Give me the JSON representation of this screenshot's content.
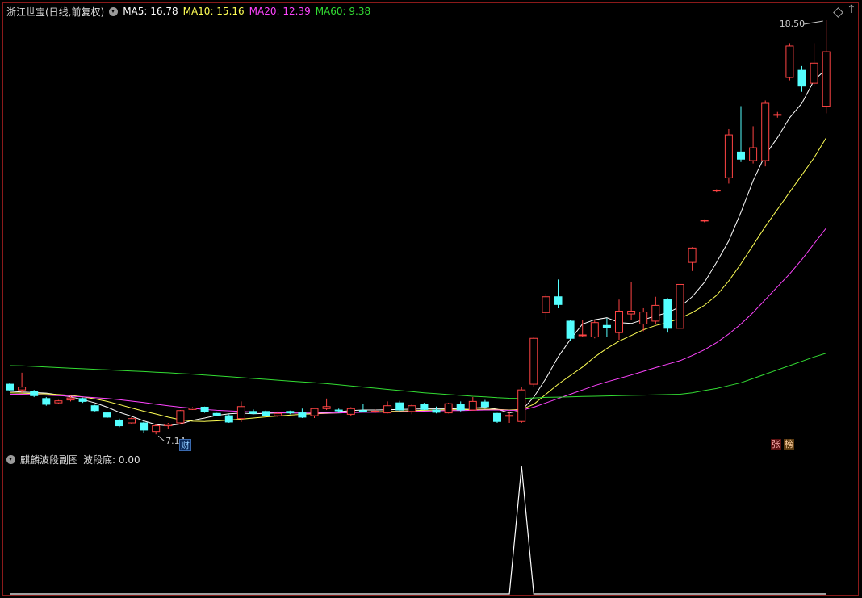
{
  "stock_name": "浙江世宝(日线,前复权)",
  "ma_legend": [
    {
      "label": "MA5: 16.78",
      "color": "#ffffff"
    },
    {
      "label": "MA10: 15.16",
      "color": "#ffff55"
    },
    {
      "label": "MA20: 12.39",
      "color": "#ff44ff"
    },
    {
      "label": "MA60: 9.38",
      "color": "#33dd33"
    }
  ],
  "sub_panel": {
    "title": "麒麟波段副图",
    "indicator": "波段底: 0.00"
  },
  "markers": {
    "high_label": "18.50",
    "low_label": "7.14",
    "cai": "财",
    "zhang": "张",
    "bang": "榜"
  },
  "colors": {
    "up": "#ff4444",
    "down": "#54ffff",
    "frame": "#8b1a1a"
  },
  "chart_data": {
    "type": "candlestick",
    "candles": [
      [
        8.3,
        8.1,
        8.35,
        8.05
      ],
      [
        8.1,
        8.2,
        8.7,
        8.0
      ],
      [
        8.05,
        7.9,
        8.1,
        7.85
      ],
      [
        7.8,
        7.6,
        7.85,
        7.55
      ],
      [
        7.65,
        7.72,
        7.75,
        7.6
      ],
      [
        7.75,
        7.82,
        7.88,
        7.7
      ],
      [
        7.8,
        7.7,
        7.83,
        7.65
      ],
      [
        7.55,
        7.38,
        7.58,
        7.35
      ],
      [
        7.3,
        7.15,
        7.32,
        7.12
      ],
      [
        7.05,
        6.85,
        7.1,
        6.8
      ],
      [
        6.95,
        7.1,
        7.15,
        6.9
      ],
      [
        6.95,
        6.7,
        7.0,
        6.6
      ],
      [
        6.65,
        6.85,
        6.9,
        6.55
      ],
      [
        6.85,
        6.9,
        6.95,
        6.75
      ],
      [
        6.95,
        7.38,
        7.4,
        6.9
      ],
      [
        7.42,
        7.47,
        7.5,
        7.4
      ],
      [
        7.5,
        7.35,
        7.52,
        7.3
      ],
      [
        7.28,
        7.22,
        7.3,
        7.18
      ],
      [
        7.2,
        6.98,
        7.25,
        6.95
      ],
      [
        7.1,
        7.52,
        7.7,
        6.98
      ],
      [
        7.35,
        7.28,
        7.42,
        7.25
      ],
      [
        7.35,
        7.2,
        7.38,
        7.18
      ],
      [
        7.2,
        7.28,
        7.35,
        7.15
      ],
      [
        7.35,
        7.3,
        7.38,
        7.25
      ],
      [
        7.3,
        7.15,
        7.45,
        7.12
      ],
      [
        7.2,
        7.45,
        7.48,
        7.12
      ],
      [
        7.45,
        7.52,
        7.8,
        7.4
      ],
      [
        7.4,
        7.38,
        7.45,
        7.3
      ],
      [
        7.25,
        7.45,
        7.5,
        7.2
      ],
      [
        7.38,
        7.36,
        7.6,
        7.32
      ],
      [
        7.35,
        7.36,
        7.42,
        7.3
      ],
      [
        7.3,
        7.55,
        7.7,
        7.28
      ],
      [
        7.65,
        7.4,
        7.72,
        7.35
      ],
      [
        7.35,
        7.55,
        7.6,
        7.25
      ],
      [
        7.6,
        7.42,
        7.65,
        7.4
      ],
      [
        7.4,
        7.32,
        7.52,
        7.28
      ],
      [
        7.3,
        7.62,
        7.65,
        7.28
      ],
      [
        7.6,
        7.4,
        7.7,
        7.35
      ],
      [
        7.4,
        7.7,
        7.85,
        7.38
      ],
      [
        7.68,
        7.52,
        7.75,
        7.45
      ],
      [
        7.28,
        7.0,
        7.3,
        6.95
      ],
      [
        7.2,
        7.21,
        7.35,
        6.95
      ],
      [
        7.0,
        8.1,
        8.2,
        6.95
      ],
      [
        8.3,
        9.9,
        9.95,
        8.2
      ],
      [
        10.8,
        11.35,
        11.45,
        10.55
      ],
      [
        11.35,
        11.08,
        11.95,
        10.95
      ],
      [
        10.5,
        9.9,
        10.55,
        9.8
      ],
      [
        10.0,
        10.02,
        10.55,
        9.95
      ],
      [
        9.95,
        10.45,
        10.55,
        9.9
      ],
      [
        10.35,
        10.28,
        10.6,
        9.95
      ],
      [
        10.1,
        10.85,
        11.25,
        9.85
      ],
      [
        10.75,
        10.85,
        11.85,
        10.55
      ],
      [
        10.4,
        10.82,
        10.95,
        10.15
      ],
      [
        10.5,
        11.05,
        11.35,
        10.4
      ],
      [
        11.25,
        10.25,
        11.3,
        10.1
      ],
      [
        10.25,
        11.78,
        11.95,
        10.05
      ],
      [
        12.55,
        13.05,
        13.08,
        12.25
      ],
      [
        14.0,
        14.02,
        14.05,
        13.95
      ],
      [
        15.05,
        15.07,
        15.1,
        15.0
      ],
      [
        15.5,
        17.0,
        17.2,
        15.3
      ],
      [
        16.4,
        16.15,
        18.0,
        16.05
      ],
      [
        16.1,
        16.55,
        17.3,
        16.0
      ],
      [
        16.1,
        18.1,
        18.2,
        15.9
      ],
      [
        17.7,
        17.71,
        17.8,
        17.6
      ],
      [
        19.0,
        20.1,
        20.2,
        18.9
      ],
      [
        19.25,
        18.7,
        19.4,
        18.5
      ],
      [
        18.8,
        19.5,
        20.2,
        18.7
      ],
      [
        18.0,
        19.9,
        21.0,
        17.75
      ]
    ],
    "ma_series": [
      {
        "name": "MA5",
        "color": "#ffffff",
        "values": [
          8.05,
          8.03,
          8.01,
          7.99,
          7.93,
          7.86,
          7.76,
          7.65,
          7.5,
          7.32,
          7.18,
          7.02,
          6.89,
          6.85,
          6.91,
          7.04,
          7.12,
          7.21,
          7.27,
          7.29,
          7.27,
          7.28,
          7.3,
          7.3,
          7.29,
          7.29,
          7.31,
          7.34,
          7.38,
          7.4,
          7.4,
          7.41,
          7.42,
          7.43,
          7.44,
          7.44,
          7.44,
          7.45,
          7.47,
          7.49,
          7.43,
          7.3,
          7.38,
          7.85,
          8.5,
          9.25,
          9.86,
          10.4,
          10.55,
          10.62,
          10.45,
          10.42,
          10.55,
          10.68,
          10.8,
          11.0,
          11.35,
          11.85,
          12.55,
          13.3,
          14.3,
          15.4,
          16.3,
          16.9,
          17.6,
          18.1,
          18.9,
          19.3
        ]
      },
      {
        "name": "MA10",
        "color": "#ffff55",
        "values": [
          8.0,
          7.99,
          7.97,
          7.96,
          7.94,
          7.91,
          7.86,
          7.79,
          7.7,
          7.59,
          7.47,
          7.36,
          7.26,
          7.15,
          7.06,
          7.01,
          7.0,
          7.02,
          7.05,
          7.08,
          7.12,
          7.16,
          7.19,
          7.22,
          7.25,
          7.27,
          7.28,
          7.3,
          7.31,
          7.33,
          7.34,
          7.35,
          7.36,
          7.38,
          7.39,
          7.4,
          7.41,
          7.41,
          7.42,
          7.43,
          7.42,
          7.4,
          7.42,
          7.6,
          7.95,
          8.3,
          8.6,
          8.9,
          9.25,
          9.55,
          9.8,
          10.0,
          10.2,
          10.35,
          10.45,
          10.6,
          10.8,
          11.05,
          11.4,
          11.9,
          12.5,
          13.15,
          13.8,
          14.4,
          15.0,
          15.6,
          16.2,
          16.9
        ]
      },
      {
        "name": "MA20",
        "color": "#ff44ff",
        "values": [
          7.95,
          7.95,
          7.94,
          7.92,
          7.9,
          7.88,
          7.86,
          7.83,
          7.8,
          7.76,
          7.71,
          7.66,
          7.6,
          7.55,
          7.5,
          7.46,
          7.42,
          7.39,
          7.37,
          7.35,
          7.33,
          7.32,
          7.31,
          7.3,
          7.29,
          7.29,
          7.29,
          7.3,
          7.31,
          7.32,
          7.32,
          7.33,
          7.34,
          7.35,
          7.36,
          7.37,
          7.38,
          7.38,
          7.39,
          7.4,
          7.4,
          7.39,
          7.39,
          7.5,
          7.65,
          7.8,
          7.95,
          8.1,
          8.25,
          8.38,
          8.5,
          8.62,
          8.75,
          8.88,
          9.0,
          9.12,
          9.3,
          9.5,
          9.75,
          10.05,
          10.4,
          10.8,
          11.25,
          11.7,
          12.15,
          12.65,
          13.2,
          13.75
        ]
      },
      {
        "name": "MA60",
        "color": "#33dd33",
        "values": [
          8.95,
          8.94,
          8.92,
          8.9,
          8.88,
          8.86,
          8.84,
          8.82,
          8.8,
          8.78,
          8.76,
          8.74,
          8.72,
          8.7,
          8.67,
          8.65,
          8.62,
          8.59,
          8.56,
          8.53,
          8.5,
          8.47,
          8.44,
          8.41,
          8.38,
          8.35,
          8.32,
          8.28,
          8.24,
          8.2,
          8.16,
          8.12,
          8.08,
          8.04,
          8.0,
          7.97,
          7.94,
          7.91,
          7.88,
          7.86,
          7.83,
          7.81,
          7.8,
          7.82,
          7.84,
          7.85,
          7.86,
          7.87,
          7.88,
          7.89,
          7.9,
          7.91,
          7.92,
          7.93,
          7.94,
          7.95,
          8.0,
          8.08,
          8.15,
          8.25,
          8.35,
          8.5,
          8.65,
          8.8,
          8.95,
          9.1,
          9.25,
          9.38
        ]
      }
    ],
    "sub_series": {
      "name": "波段底",
      "values": [
        0,
        0,
        0,
        0,
        0,
        0,
        0,
        0,
        0,
        0,
        0,
        0,
        0,
        0,
        0,
        0,
        0,
        0,
        0,
        0,
        0,
        0,
        0,
        0,
        0,
        0,
        0,
        0,
        0,
        0,
        0,
        0,
        0,
        0,
        0,
        0,
        0,
        0,
        0,
        0,
        0,
        0,
        1,
        0,
        0,
        0,
        0,
        0,
        0,
        0,
        0,
        0,
        0,
        0,
        0,
        0,
        0,
        0,
        0,
        0,
        0,
        0,
        0,
        0,
        0,
        0,
        0,
        0
      ]
    }
  }
}
